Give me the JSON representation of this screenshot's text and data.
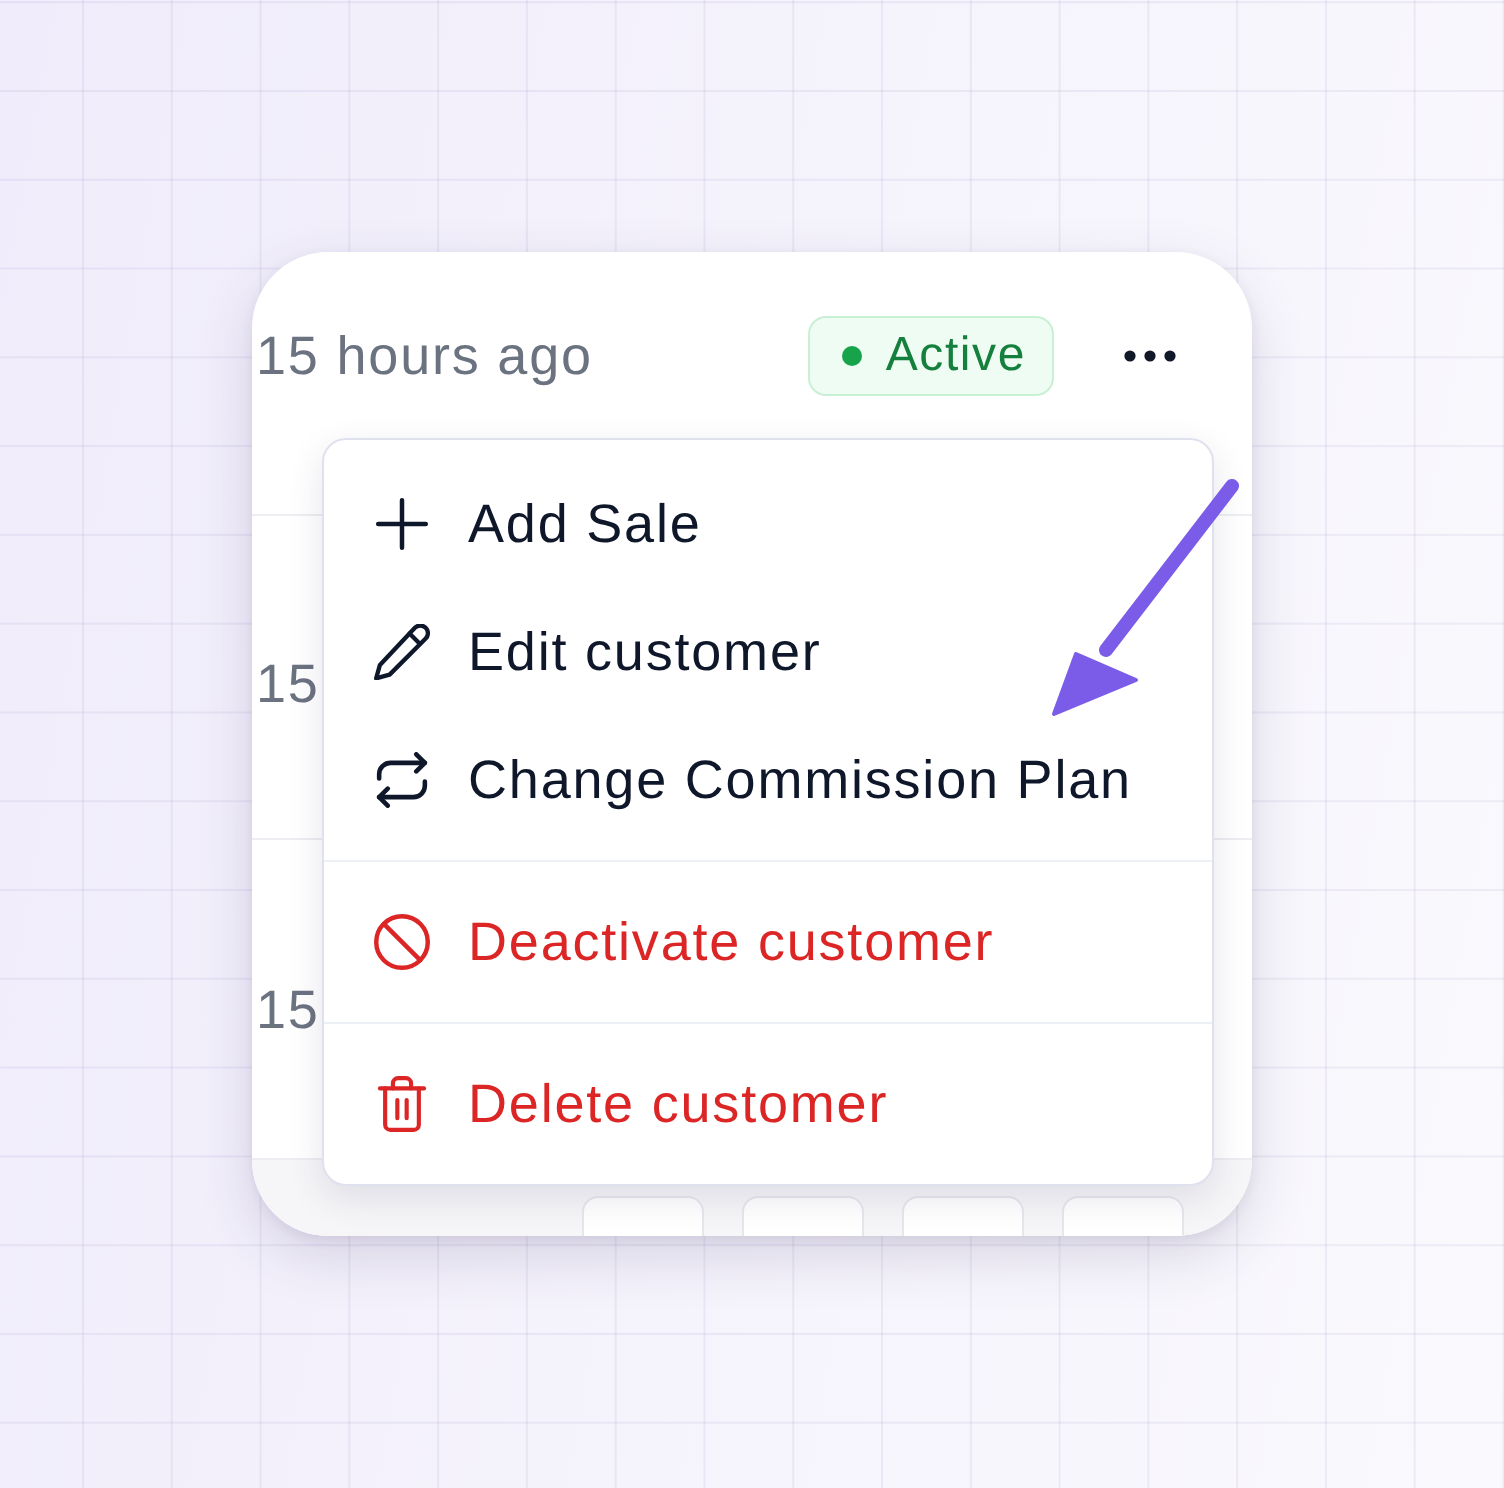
{
  "card": {
    "header": {
      "time": "15 hours ago",
      "status": "Active"
    },
    "rows": [
      {
        "time": "15"
      },
      {
        "time": "15"
      }
    ]
  },
  "menu": {
    "sections": [
      {
        "items": [
          {
            "label": "Add Sale",
            "kind": "add",
            "danger": false
          },
          {
            "label": "Edit customer",
            "kind": "edit",
            "danger": false
          },
          {
            "label": "Change Commission Plan",
            "kind": "change",
            "danger": false
          }
        ]
      },
      {
        "items": [
          {
            "label": "Deactivate customer",
            "kind": "deactivate",
            "danger": true
          }
        ]
      },
      {
        "items": [
          {
            "label": "Delete customer",
            "kind": "delete",
            "danger": true
          }
        ]
      }
    ]
  }
}
